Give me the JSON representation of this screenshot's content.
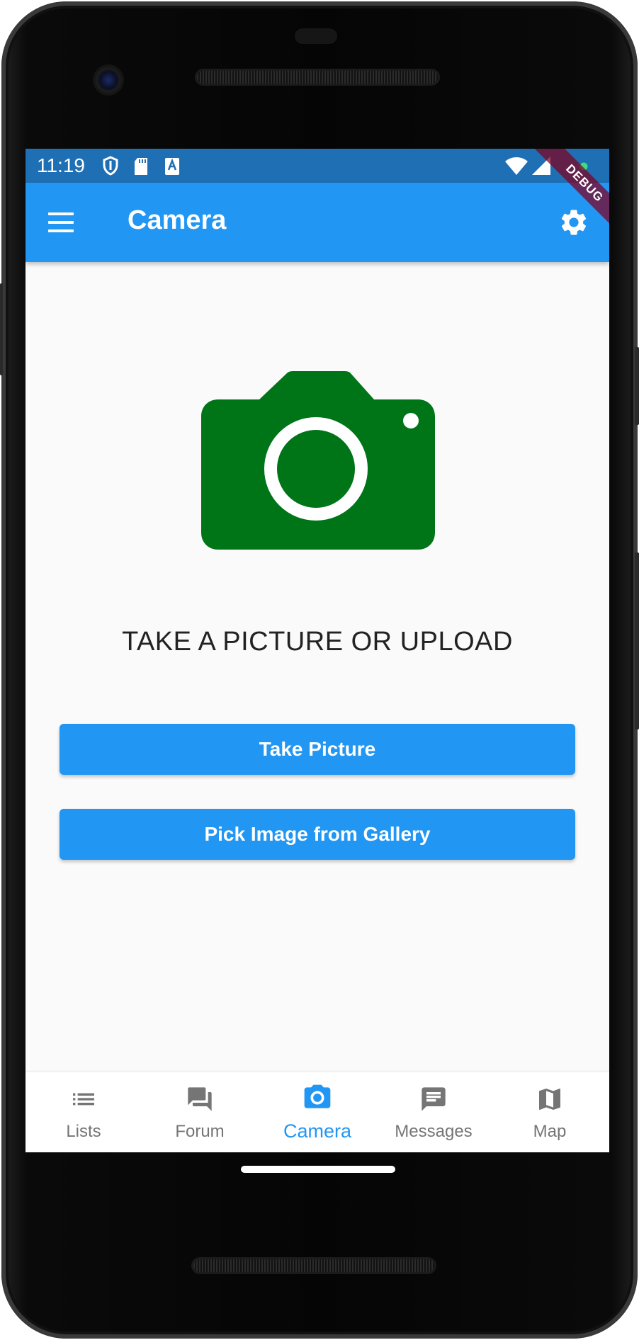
{
  "status_bar": {
    "time": "11:19",
    "icons": [
      "shield-icon",
      "sd-card-icon",
      "a-icon",
      "wifi-icon",
      "signal-icon",
      "green-dot-icon"
    ]
  },
  "app_bar": {
    "title": "Camera",
    "menu_icon": "menu-icon",
    "settings_icon": "gear-icon",
    "debug_label": "DEBUG"
  },
  "main": {
    "hero_icon": "camera-icon",
    "headline": "TAKE A PICTURE OR UPLOAD",
    "take_picture_label": "Take Picture",
    "pick_gallery_label": "Pick Image from Gallery"
  },
  "bottom_nav": {
    "items": [
      {
        "label": "Lists",
        "icon": "list-icon"
      },
      {
        "label": "Forum",
        "icon": "forum-icon"
      },
      {
        "label": "Camera",
        "icon": "camera-icon"
      },
      {
        "label": "Messages",
        "icon": "message-icon"
      },
      {
        "label": "Map",
        "icon": "map-icon"
      }
    ],
    "active_index": 2
  },
  "colors": {
    "primary": "#2196f3",
    "status_bar": "#1f6fb5",
    "hero_icon": "#007518",
    "nav_inactive": "#757575",
    "background": "#fafafa"
  }
}
